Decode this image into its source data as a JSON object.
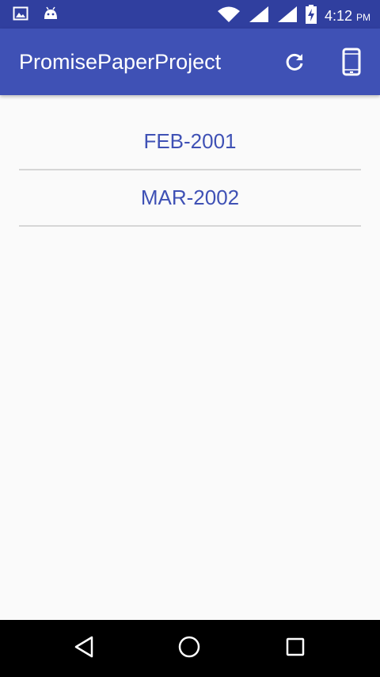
{
  "status_bar": {
    "time": "4:12",
    "ampm": "PM",
    "icons": [
      "image-notification-icon",
      "android-notification-icon",
      "wifi-icon",
      "signal-icon",
      "signal-icon",
      "battery-charging-icon"
    ]
  },
  "app_bar": {
    "title": "PromisePaperProject",
    "actions": [
      "refresh-icon",
      "smartphone-icon"
    ]
  },
  "list": {
    "items": [
      {
        "label": "FEB-2001"
      },
      {
        "label": "MAR-2002"
      }
    ]
  },
  "nav_bar": {
    "buttons": [
      "back-icon",
      "home-icon",
      "recents-icon"
    ]
  },
  "colors": {
    "status_bar": "#303f9f",
    "app_bar": "#3f51b5",
    "accent_text": "#3f51b5",
    "background": "#fafafa",
    "divider": "#d6d6d6"
  }
}
